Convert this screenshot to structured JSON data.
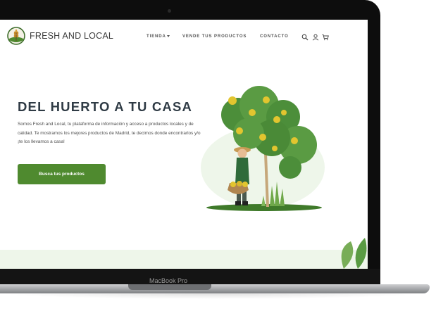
{
  "device": {
    "model_label": "MacBook Pro"
  },
  "site": {
    "brand": "FRESH AND LOCAL",
    "nav": {
      "tienda": "TIENDA",
      "vende": "VENDE TUS PRODUCTOS",
      "contacto": "CONTACTO"
    },
    "icons": [
      "search-icon",
      "user-icon",
      "cart-icon",
      "chevron-down-icon"
    ]
  },
  "hero": {
    "title": "DEL HUERTO A TU CASA",
    "description": "Somos Fresh and Local, tu plataforma de información y acceso a productos locales y de calidad. Te mostramos los mejores productos de Madrid, te decimos donde encontrarlos y/o ¡te los llevamos a casa!",
    "cta": "Busca tus productos"
  },
  "colors": {
    "accent": "#4f8a2f",
    "heading": "#2f3b45",
    "footer_band": "#eef6ea"
  }
}
